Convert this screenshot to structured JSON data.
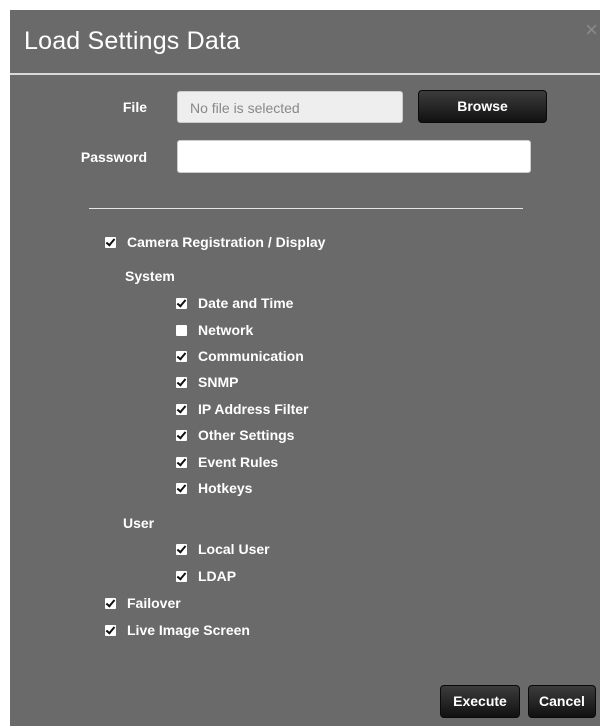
{
  "dialog": {
    "title": "Load Settings Data",
    "close_icon": "close-icon"
  },
  "form": {
    "file_label": "File",
    "file_placeholder": "No file is selected",
    "browse_label": "Browse",
    "password_label": "Password",
    "password_value": ""
  },
  "options": {
    "camera_registration": {
      "label": "Camera Registration / Display",
      "checked": true
    },
    "system_label": "System",
    "system_items": [
      {
        "label": "Date and Time",
        "checked": true
      },
      {
        "label": "Network",
        "checked": false
      },
      {
        "label": "Communication",
        "checked": true
      },
      {
        "label": "SNMP",
        "checked": true
      },
      {
        "label": "IP Address Filter",
        "checked": true
      },
      {
        "label": "Other Settings",
        "checked": true
      },
      {
        "label": "Event Rules",
        "checked": true
      },
      {
        "label": "Hotkeys",
        "checked": true
      }
    ],
    "user_label": "User",
    "user_items": [
      {
        "label": "Local User",
        "checked": true
      },
      {
        "label": "LDAP",
        "checked": true
      }
    ],
    "failover": {
      "label": "Failover",
      "checked": true
    },
    "live_image": {
      "label": "Live Image Screen",
      "checked": true
    }
  },
  "actions": {
    "execute_label": "Execute",
    "cancel_label": "Cancel"
  },
  "colors": {
    "dialog_bg": "#6a6a6a",
    "button_bg": "#1a1a1a",
    "text": "#ffffff"
  }
}
